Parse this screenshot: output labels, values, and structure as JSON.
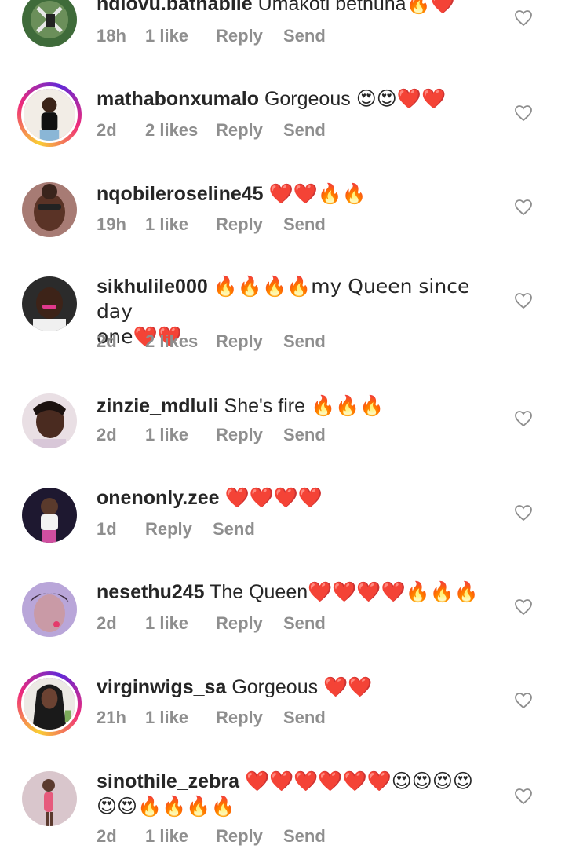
{
  "comments": [
    {
      "username": "ndlovu.bathabile",
      "text": "Umakoti bethuna",
      "emoji": "🔥❤️",
      "time": "18h",
      "likes": "1 like",
      "reply": "Reply",
      "send": "Send"
    },
    {
      "username": "mathabonxumalo",
      "text": "Gorgeous",
      "emoji": "😍😍❤️❤️",
      "time": "2d",
      "likes": "2 likes",
      "reply": "Reply",
      "send": "Send"
    },
    {
      "username": "nqobileroseline45",
      "text": "",
      "emoji": "❤️❤️🔥🔥",
      "time": "19h",
      "likes": "1 like",
      "reply": "Reply",
      "send": "Send"
    },
    {
      "username": "sikhulile000",
      "text_line1": "🔥🔥🔥🔥my Queen since day",
      "text_line2": "one❤️❤️",
      "time": "2d",
      "likes": "2 likes",
      "reply": "Reply",
      "send": "Send"
    },
    {
      "username": "zinzie_mdluli",
      "text": "She's fire",
      "emoji": "🔥🔥🔥",
      "time": "2d",
      "likes": "1 like",
      "reply": "Reply",
      "send": "Send"
    },
    {
      "username": "onenonly.zee",
      "text": "",
      "emoji": "❤️❤️❤️❤️",
      "time": "1d",
      "reply": "Reply",
      "send": "Send"
    },
    {
      "username": "nesethu245",
      "text": "The Queen",
      "emoji": "❤️❤️❤️❤️🔥🔥🔥",
      "time": "2d",
      "likes": "1 like",
      "reply": "Reply",
      "send": "Send"
    },
    {
      "username": "virginwigs_sa",
      "text": "Gorgeous",
      "emoji": "❤️❤️",
      "time": "21h",
      "likes": "1 like",
      "reply": "Reply",
      "send": "Send"
    },
    {
      "username": "sinothile_zebra",
      "emoji_line1": "❤️❤️❤️❤️❤️❤️😍😍😍😍",
      "emoji_line2": "😍😍🔥🔥🔥🔥",
      "time": "2d",
      "likes": "1 like",
      "reply": "Reply",
      "send": "Send"
    }
  ],
  "icons": {
    "like": "heart-outline-icon"
  },
  "colors": {
    "text": "#262626",
    "meta": "#8e8e8e",
    "heart_outline": "#8e8e8e",
    "story_ring_start": "#f9ce34",
    "story_ring_mid": "#ee2a7b",
    "story_ring_end": "#6228d7"
  }
}
